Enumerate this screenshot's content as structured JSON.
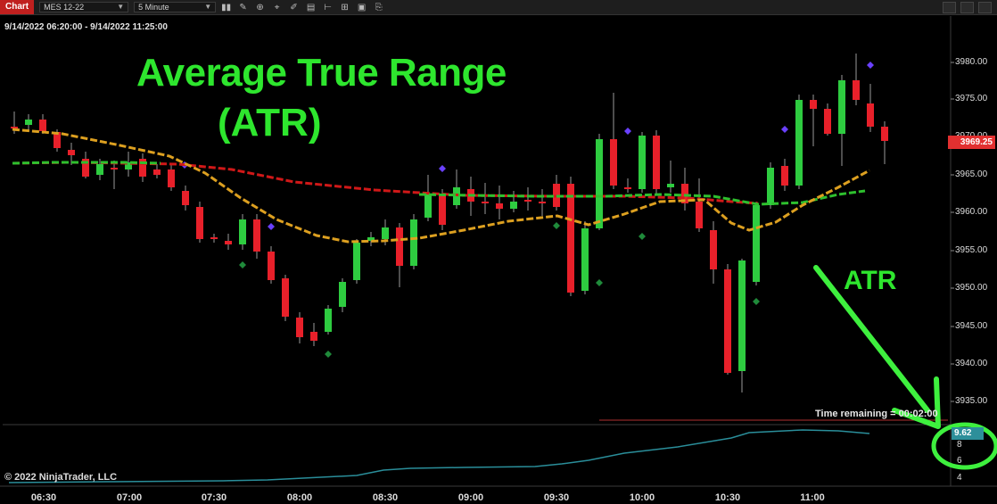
{
  "toolbar": {
    "tab_label": "Chart",
    "instrument": "MES 12-22",
    "interval": "5 Minute",
    "icons": [
      "bar-type-icon",
      "pencil-icon",
      "zoom-icon",
      "crosshair-icon",
      "properties-icon",
      "strategies-icon",
      "indicators-icon",
      "data-box-icon",
      "attach-icon"
    ]
  },
  "chart": {
    "date_range": "9/14/2022 06:20:00 - 9/14/2022 11:25:00",
    "title_line1": "Average True Range",
    "title_line2": "(ATR)",
    "annotation_label": "ATR",
    "time_remaining": "Time remaining = 00:02:00",
    "copyright": "© 2022 NinjaTrader, LLC",
    "current_price": "3969.25",
    "current_atr": "9.62",
    "annotation_color": "#2ee62e",
    "up_color": "#2ecc40",
    "down_color": "#e8202a"
  },
  "y_axis": [
    "3980.00",
    "3975.00",
    "3970.00",
    "3965.00",
    "3960.00",
    "3955.00",
    "3950.00",
    "3945.00",
    "3940.00",
    "3935.00"
  ],
  "indicator_axis": [
    "8",
    "6",
    "4"
  ],
  "x_axis": [
    "06:30",
    "07:00",
    "07:30",
    "08:00",
    "08:30",
    "09:00",
    "09:30",
    "10:00",
    "10:30",
    "11:00"
  ]
}
